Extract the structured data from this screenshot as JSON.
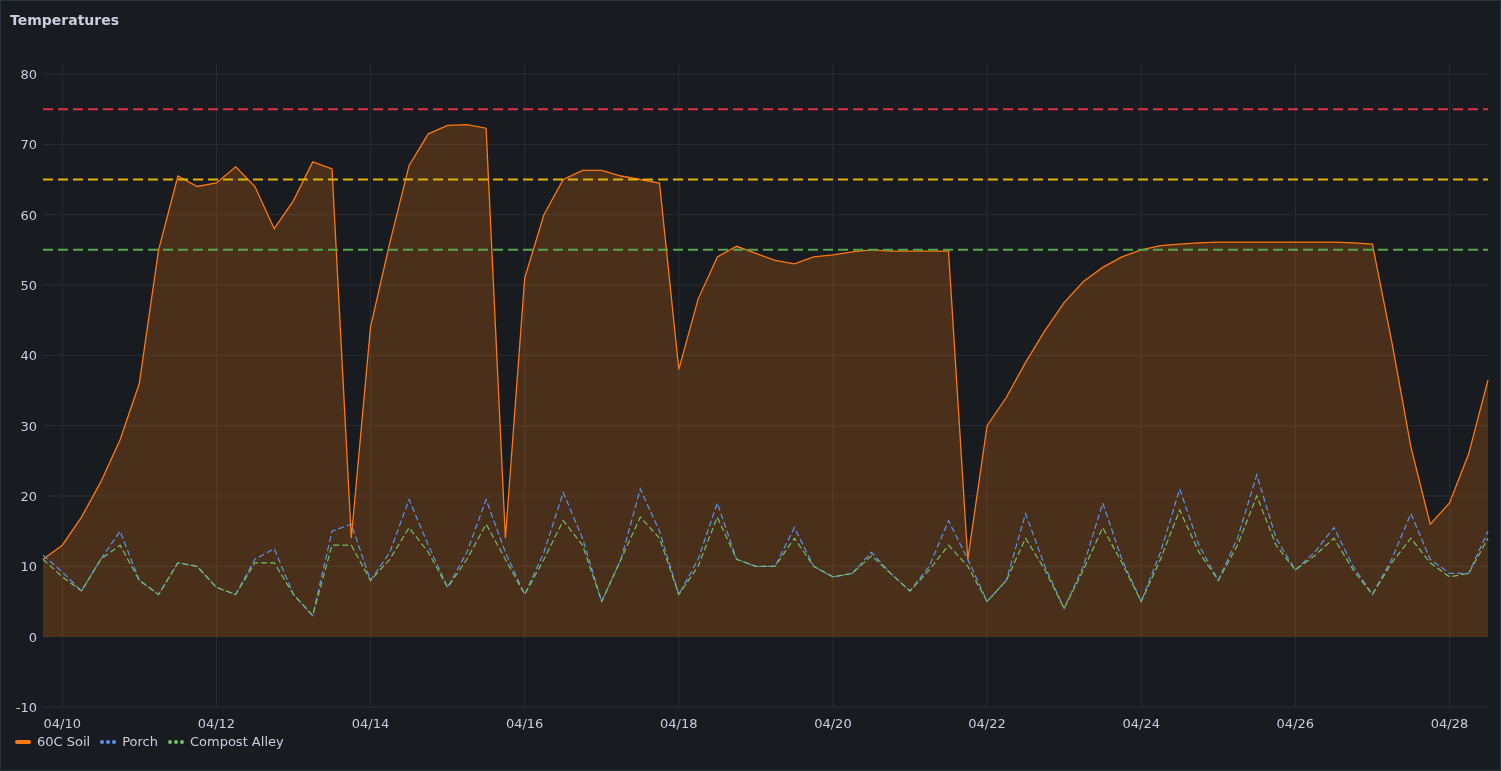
{
  "panel": {
    "title": "Temperatures",
    "chart_data": {
      "type": "area",
      "categories": [
        null,
        "04/10",
        null,
        null,
        null,
        null,
        null,
        null,
        null,
        "04/12",
        null,
        null,
        null,
        null,
        null,
        null,
        null,
        "04/14",
        null,
        null,
        null,
        null,
        null,
        null,
        null,
        "04/16",
        null,
        null,
        null,
        null,
        null,
        null,
        null,
        "04/18",
        null,
        null,
        null,
        null,
        null,
        null,
        null,
        "04/20",
        null,
        null,
        null,
        null,
        null,
        null,
        null,
        "04/22",
        null,
        null,
        null,
        null,
        null,
        null,
        null,
        "04/24",
        null,
        null,
        null,
        null,
        null,
        null,
        null,
        "04/26",
        null,
        null,
        null,
        null,
        null,
        null,
        null,
        "04/28",
        null,
        null
      ],
      "series": [
        {
          "name": "60C Soil",
          "color": "#ff780a",
          "type": "area",
          "values": [
            11,
            13,
            17,
            22,
            28,
            36,
            55,
            65.5,
            64,
            64.5,
            66.8,
            64,
            58,
            62,
            67.5,
            66.5,
            14,
            44,
            56,
            67,
            71.5,
            72.7,
            72.8,
            72.3,
            14,
            51,
            60,
            65,
            66.3,
            66.3,
            65.5,
            65,
            64.5,
            38,
            48,
            54,
            55.5,
            54.5,
            53.5,
            53,
            54,
            54.3,
            54.7,
            55,
            54.8,
            54.8,
            54.8,
            54.8,
            11,
            30,
            34,
            39,
            43.5,
            47.5,
            50.5,
            52.5,
            54,
            55,
            55.6,
            55.8,
            56,
            56.1,
            56.1,
            56.1,
            56.1,
            56.1,
            56.1,
            56.1,
            56,
            55.8,
            42,
            27,
            16,
            19,
            26,
            36.5
          ]
        },
        {
          "name": "Porch",
          "color": "#5794f2",
          "type": "line",
          "line_style": "dashed",
          "values": [
            11.6,
            9.2,
            6.5,
            11,
            15,
            8,
            6,
            10.5,
            10,
            7,
            6,
            11,
            12.5,
            6,
            3,
            15,
            16,
            8,
            12,
            19.5,
            13,
            7,
            12,
            19.5,
            12,
            6,
            12,
            20.5,
            14,
            5,
            11,
            21,
            15,
            6,
            11,
            19,
            11,
            10,
            10,
            15.5,
            10,
            8.5,
            9,
            12,
            9,
            6.5,
            10,
            16.5,
            11,
            5,
            8,
            17.5,
            10,
            4,
            10,
            19,
            11,
            5,
            12,
            21,
            13,
            8,
            14,
            23,
            14,
            9.5,
            12,
            15.5,
            10,
            6,
            11,
            17.5,
            11,
            9,
            9,
            15
          ]
        },
        {
          "name": "Compost Alley",
          "color": "#73bf69",
          "type": "line",
          "line_style": "dashed",
          "values": [
            11,
            8.5,
            6.5,
            11,
            13,
            8,
            6,
            10.5,
            10,
            7,
            6,
            10.5,
            10.5,
            6,
            3,
            13,
            13,
            8,
            11,
            15.5,
            12,
            7,
            11,
            16,
            11,
            6,
            11,
            16.5,
            13,
            5,
            11,
            17,
            14,
            6,
            10,
            17,
            11,
            10,
            10,
            14,
            10,
            8.5,
            9,
            11.5,
            9,
            6.5,
            9.5,
            13,
            10,
            5,
            8,
            14,
            9.5,
            4,
            9.5,
            15.5,
            10.5,
            5,
            11,
            18,
            12,
            8,
            13,
            20,
            13,
            9.5,
            11.5,
            14,
            9.5,
            6,
            10.5,
            14,
            10.5,
            8.5,
            9,
            14
          ]
        }
      ],
      "ylim": [
        -10,
        80
      ],
      "yticks": [
        -10,
        0,
        10,
        20,
        30,
        40,
        50,
        60,
        70,
        80
      ],
      "grid": true,
      "ref_lines": [
        {
          "axis": "y",
          "value": 75,
          "color": "#e02f44",
          "line_style": "dashed"
        },
        {
          "axis": "y",
          "value": 65,
          "color": "#e0b400",
          "line_style": "dashed"
        },
        {
          "axis": "y",
          "value": 55,
          "color": "#56a64b",
          "line_style": "dashed"
        }
      ]
    }
  }
}
